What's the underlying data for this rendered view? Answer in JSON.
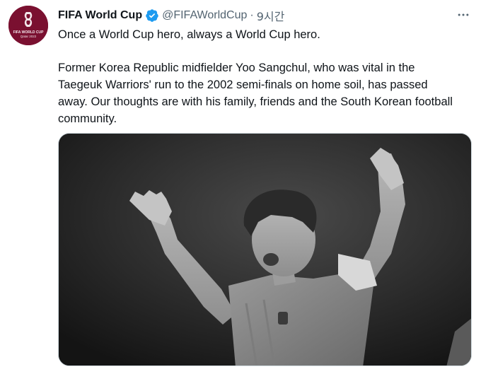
{
  "account": {
    "name": "FIFA World Cup",
    "handle": "@FIFAWorldCup",
    "separator": "·",
    "time": "9시간",
    "avatar_icon": "fifa-world-cup-qatar-2022-logo",
    "avatar_caption": "FIFA WORLD CUP Qatar 2022",
    "avatar_color": "#7a1030",
    "verified_color": "#1d9bf0"
  },
  "tweet": {
    "line1": "Once a World Cup hero, always a World Cup hero.",
    "line2": "Former Korea Republic midfielder Yoo Sangchul, who was vital in the Taegeuk Warriors' run to the 2002 semi-finals on home soil, has passed away. Our thoughts are with his family, friends and the South Korean football community."
  },
  "media": {
    "description_icon": "celebrating-player-photo"
  },
  "more_icon": "more-options-icon"
}
